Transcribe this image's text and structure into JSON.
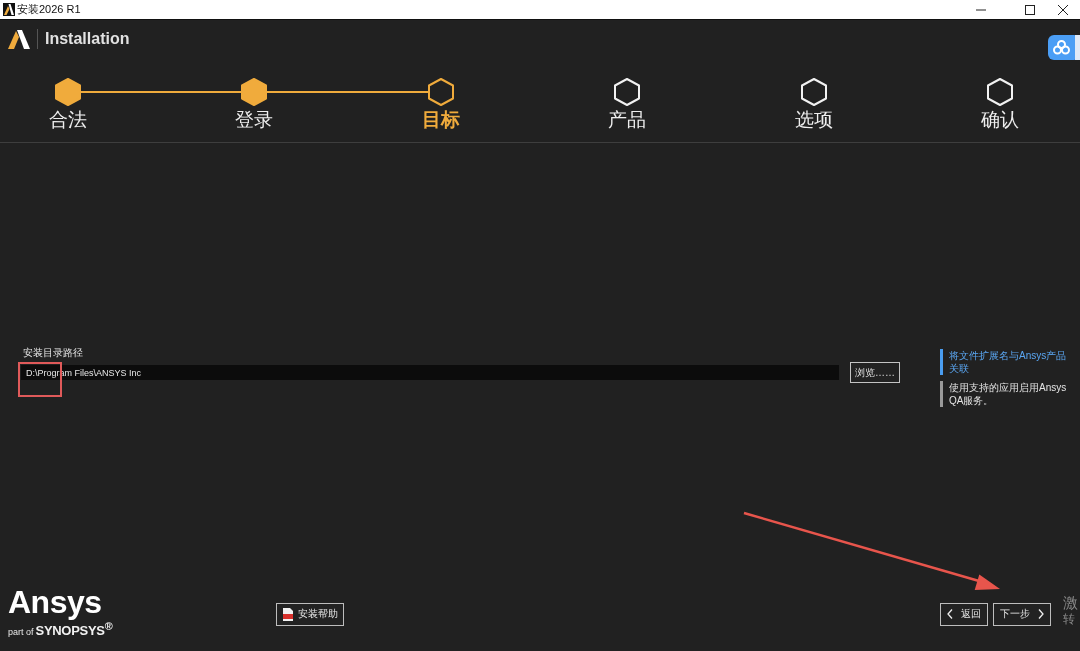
{
  "window": {
    "title": "安装2026 R1"
  },
  "header": {
    "title": "Installation"
  },
  "steps": [
    {
      "label": "合法",
      "done": true,
      "selected": false
    },
    {
      "label": "登录",
      "done": true,
      "selected": false
    },
    {
      "label": "目标",
      "done": false,
      "selected": true
    },
    {
      "label": "产品",
      "done": false,
      "selected": false
    },
    {
      "label": "选项",
      "done": false,
      "selected": false
    },
    {
      "label": "确认",
      "done": false,
      "selected": false
    }
  ],
  "install_path": {
    "label": "安装目录路径",
    "value": "D:\\Program Files\\ANSYS Inc",
    "annotated_box": true,
    "browse_button": "浏览……"
  },
  "options": [
    {
      "label": "将文件扩展名与Ansys产品关联",
      "checked": true
    },
    {
      "label": "使用支持的应用启用Ansys QA服务。",
      "checked": false
    }
  ],
  "footer": {
    "logo": {
      "name": "Ansys",
      "tagline": "part of",
      "company": "SYNOPSYS$^{®}$"
    },
    "help_button": "安装帮助",
    "nav_buttons": [
      {
        "label": "返回",
        "kind": "back",
        "annotated_arrow": false
      },
      {
        "label": "下一步",
        "kind": "next",
        "annotated_arrow": true
      }
    ]
  },
  "system_watermark": {
    "lines": [
      "激",
      "转"
    ]
  }
}
